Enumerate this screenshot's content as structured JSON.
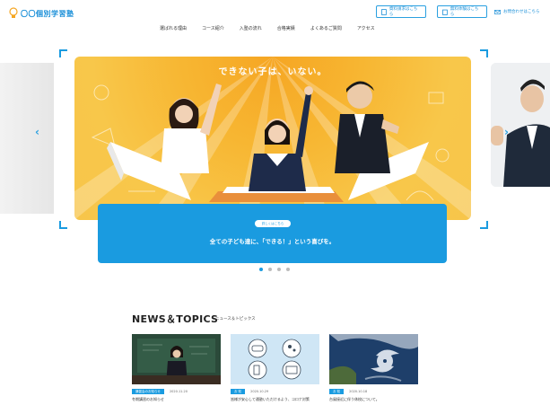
{
  "header": {
    "logo_text": "〇〇個別学習塾",
    "buttons": [
      {
        "label": "資料請求はこちら",
        "icon": "document-icon"
      },
      {
        "label": "無料体験はこちら",
        "icon": "calendar-icon"
      },
      {
        "label": "お問合わせはこちら",
        "icon": "mail-icon"
      }
    ],
    "nav": [
      "選ばれる理由",
      "コース紹介",
      "入塾の流れ",
      "合格実績",
      "よくあるご質問",
      "アクセス"
    ]
  },
  "hero": {
    "headline": "できない子は、いない。",
    "tag": "詳しくはこちら",
    "caption": "全ての子ども達に、「できる！」という喜びを。",
    "slide_count": 4,
    "active_slide": 0,
    "colors": {
      "accent": "#1a9be0",
      "hero_bg": "#f7b632"
    }
  },
  "news": {
    "title": "NEWS＆TOPICS",
    "subtitle": "ニュース＆トピックス",
    "items": [
      {
        "category": "講習会のお知らせ",
        "date": "2020.11.20",
        "title": "冬期講習のお知らせ"
      },
      {
        "category": "お 知",
        "date": "2020.10.29",
        "title": "皆様が安心して通塾いただけるよう、コロナ対策"
      },
      {
        "category": "お 知",
        "date": "2020.10.18",
        "title": "台風接近に伴う休校について。"
      }
    ]
  }
}
